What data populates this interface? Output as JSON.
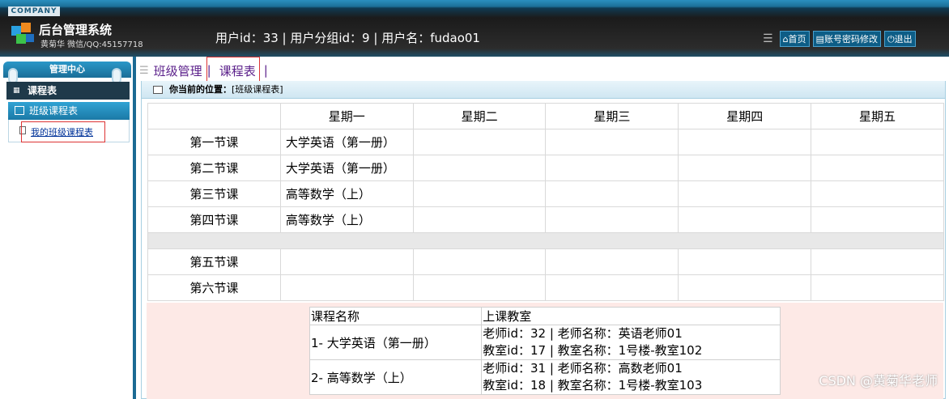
{
  "header": {
    "company": "COMPANY",
    "title": "后台管理系统",
    "subtitle": "黄菊华 微信/QQ:45157718",
    "user_info": "用户id：33 | 用户分组id：9 | 用户名：fudao01",
    "links": [
      "首页",
      "账号密码修改",
      "退出"
    ]
  },
  "sidebar": {
    "top_label": "管理中心",
    "bar_label": "课程表",
    "group_label": "班级课程表",
    "items": [
      "我的班级课程表"
    ]
  },
  "tabs": [
    "班级管理",
    "课程表"
  ],
  "location": {
    "prefix": "你当前的位置：",
    "value": "[班级课程表]"
  },
  "schedule": {
    "days": [
      "星期一",
      "星期二",
      "星期三",
      "星期四",
      "星期五"
    ],
    "periods": [
      "第一节课",
      "第二节课",
      "第三节课",
      "第四节课",
      "第五节课",
      "第六节课"
    ],
    "cells": [
      [
        "大学英语（第一册）",
        "",
        "",
        "",
        ""
      ],
      [
        "大学英语（第一册）",
        "",
        "",
        "",
        ""
      ],
      [
        "高等数学（上）",
        "",
        "",
        "",
        ""
      ],
      [
        "高等数学（上）",
        "",
        "",
        "",
        ""
      ],
      [
        "",
        "",
        "",
        "",
        ""
      ],
      [
        "",
        "",
        "",
        "",
        ""
      ]
    ]
  },
  "legend": {
    "headers": [
      "课程名称",
      "上课教室"
    ],
    "rows": [
      {
        "name": "1- 大学英语（第一册）",
        "teacher": "老师id：32 | 老师名称：英语老师01",
        "room": "教室id：17 | 教室名称：1号楼-教室102"
      },
      {
        "name": "2- 高等数学（上）",
        "teacher": "老师id：31 | 老师名称：高数老师01",
        "room": "教室id：18 | 教室名称：1号楼-教室103"
      }
    ]
  },
  "watermark": "CSDN @黄菊华老师"
}
